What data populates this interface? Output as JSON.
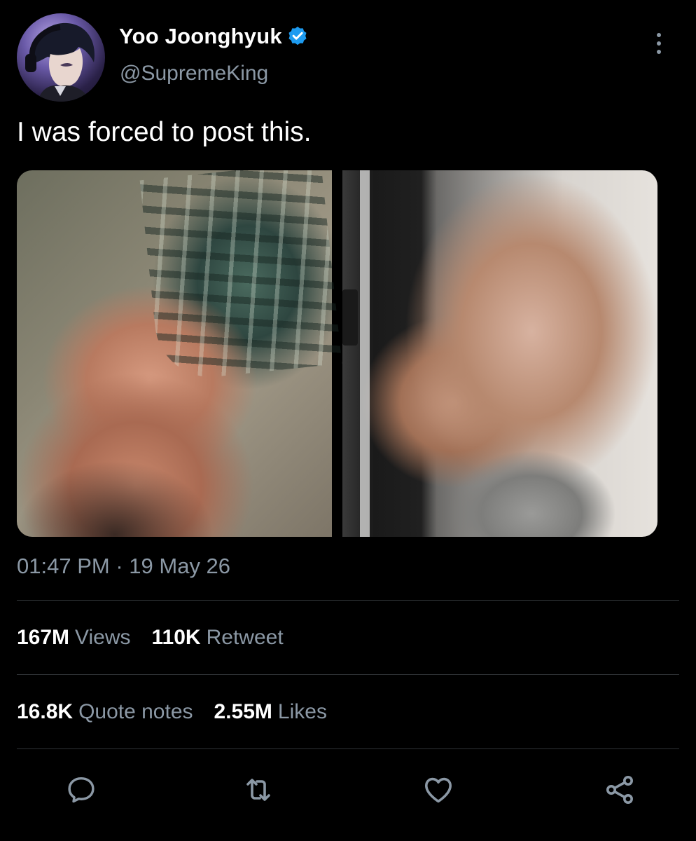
{
  "author": {
    "display_name": "Yoo Joonghyuk",
    "handle": "@SupremeKing",
    "verified": true,
    "avatar_icon": "anime-character-avatar"
  },
  "tweet": {
    "text": "I was forced to post this.",
    "media": [
      {
        "icon": "photo-shirtless-torso"
      },
      {
        "icon": "photo-muscular-back-mirror"
      }
    ],
    "time": "01:47 PM",
    "separator": "·",
    "date": "19 May 26"
  },
  "stats": {
    "views_value": "167M",
    "views_label": "Views",
    "retweets_value": "110K",
    "retweets_label": "Retweet",
    "quotes_value": "16.8K",
    "quotes_label": "Quote notes",
    "likes_value": "2.55M",
    "likes_label": "Likes"
  },
  "actions": {
    "reply_icon": "comment-icon",
    "retweet_icon": "retweet-icon",
    "like_icon": "heart-icon",
    "share_icon": "share-icon"
  },
  "colors": {
    "background": "#000000",
    "primary_text": "#ffffff",
    "secondary_text": "#8b98a5",
    "verified_blue": "#1d9bf0",
    "divider": "#2f3336"
  }
}
